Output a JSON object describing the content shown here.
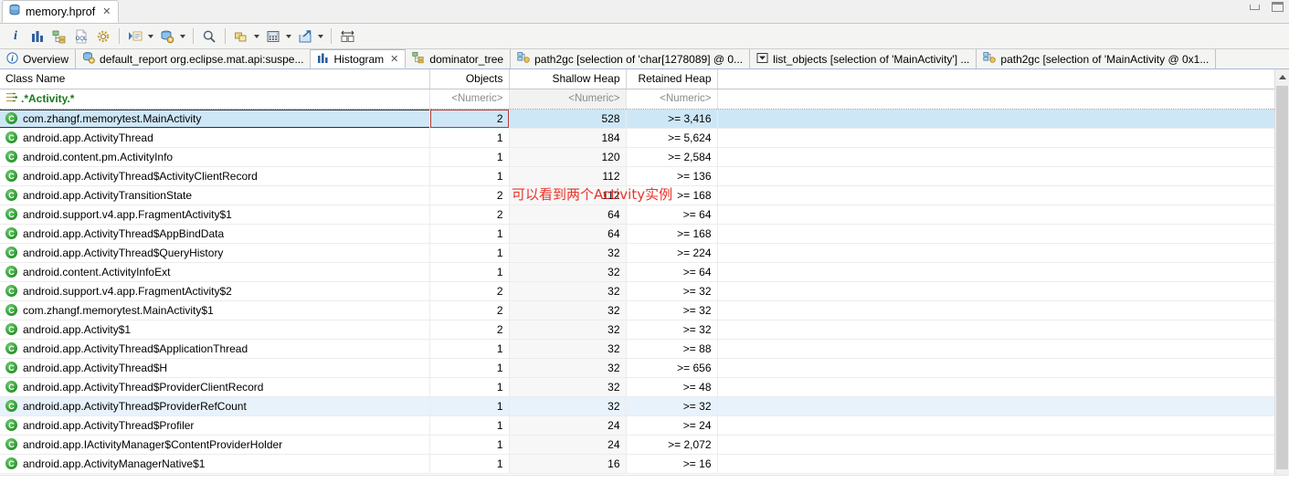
{
  "window": {
    "file_tab": {
      "title": "memory.hprof",
      "icon": "heap-dump-icon",
      "close": "✕"
    },
    "controls": {
      "minimize": "minimize-icon",
      "maximize": "maximize-icon"
    }
  },
  "toolbar": {
    "items": [
      {
        "name": "heap-dump-overview-icon",
        "glyph": "i",
        "arrow": false
      },
      {
        "name": "histogram-icon",
        "glyph": "bars",
        "arrow": false
      },
      {
        "name": "dominator-tree-icon",
        "glyph": "tree",
        "arrow": false
      },
      {
        "name": "oql-icon",
        "glyph": "oql",
        "arrow": false
      },
      {
        "name": "settings-icon",
        "glyph": "gear",
        "arrow": false
      },
      {
        "name": "sep-1",
        "glyph": "sep",
        "arrow": false
      },
      {
        "name": "run-expert-system-test-icon",
        "glyph": "runlist",
        "arrow": true
      },
      {
        "name": "query-browser-icon",
        "glyph": "queryball",
        "arrow": true
      },
      {
        "name": "sep-2",
        "glyph": "sep",
        "arrow": false
      },
      {
        "name": "find-icon",
        "glyph": "magnifier",
        "arrow": false
      },
      {
        "name": "sep-3",
        "glyph": "sep",
        "arrow": false
      },
      {
        "name": "group-by-icon",
        "glyph": "stack",
        "arrow": true
      },
      {
        "name": "calculator-icon",
        "glyph": "calc",
        "arrow": true
      },
      {
        "name": "export-icon",
        "glyph": "export",
        "arrow": true
      },
      {
        "name": "sep-4",
        "glyph": "sep",
        "arrow": false
      },
      {
        "name": "compare-icon",
        "glyph": "compare",
        "arrow": false
      }
    ]
  },
  "view_tabs": [
    {
      "label": "Overview",
      "icon": "info-icon",
      "active": false,
      "closable": false
    },
    {
      "label": "default_report  org.eclipse.mat.api:suspe...",
      "icon": "report-icon",
      "active": false,
      "closable": false
    },
    {
      "label": "Histogram",
      "icon": "histogram-icon",
      "active": true,
      "closable": true,
      "close": "✕"
    },
    {
      "label": "dominator_tree",
      "icon": "tree-icon",
      "active": false,
      "closable": false
    },
    {
      "label": "path2gc [selection of 'char[1278089] @ 0...",
      "icon": "path2gc-icon",
      "active": false,
      "closable": false
    },
    {
      "label": "list_objects [selection of 'MainActivity'] ...",
      "icon": "list-objects-icon",
      "active": false,
      "closable": false
    },
    {
      "label": "path2gc [selection of 'MainActivity @ 0x1...",
      "icon": "path2gc-icon",
      "active": false,
      "closable": false
    }
  ],
  "table": {
    "columns": [
      "Class Name",
      "Objects",
      "Shallow Heap",
      "Retained Heap"
    ],
    "filter_row": {
      "class_filter": ".*Activity.*",
      "objects_filter": "<Numeric>",
      "shallow_filter": "<Numeric>",
      "retained_filter": "<Numeric>",
      "filter_icon": "regex-filter-icon"
    },
    "rows": [
      {
        "class": "com.zhangf.memorytest.MainActivity",
        "objects": "2",
        "shallow": "528",
        "retained": ">= 3,416",
        "selected": true,
        "hover": false
      },
      {
        "class": "android.app.ActivityThread",
        "objects": "1",
        "shallow": "184",
        "retained": ">= 5,624",
        "selected": false,
        "hover": false
      },
      {
        "class": "android.content.pm.ActivityInfo",
        "objects": "1",
        "shallow": "120",
        "retained": ">= 2,584",
        "selected": false,
        "hover": false
      },
      {
        "class": "android.app.ActivityThread$ActivityClientRecord",
        "objects": "1",
        "shallow": "112",
        "retained": ">= 136",
        "selected": false,
        "hover": false
      },
      {
        "class": "android.app.ActivityTransitionState",
        "objects": "2",
        "shallow": "112",
        "retained": ">= 168",
        "selected": false,
        "hover": false
      },
      {
        "class": "android.support.v4.app.FragmentActivity$1",
        "objects": "2",
        "shallow": "64",
        "retained": ">= 64",
        "selected": false,
        "hover": false
      },
      {
        "class": "android.app.ActivityThread$AppBindData",
        "objects": "1",
        "shallow": "64",
        "retained": ">= 168",
        "selected": false,
        "hover": false
      },
      {
        "class": "android.app.ActivityThread$QueryHistory",
        "objects": "1",
        "shallow": "32",
        "retained": ">= 224",
        "selected": false,
        "hover": false
      },
      {
        "class": "android.content.ActivityInfoExt",
        "objects": "1",
        "shallow": "32",
        "retained": ">= 64",
        "selected": false,
        "hover": false
      },
      {
        "class": "android.support.v4.app.FragmentActivity$2",
        "objects": "2",
        "shallow": "32",
        "retained": ">= 32",
        "selected": false,
        "hover": false
      },
      {
        "class": "com.zhangf.memorytest.MainActivity$1",
        "objects": "2",
        "shallow": "32",
        "retained": ">= 32",
        "selected": false,
        "hover": false
      },
      {
        "class": "android.app.Activity$1",
        "objects": "2",
        "shallow": "32",
        "retained": ">= 32",
        "selected": false,
        "hover": false
      },
      {
        "class": "android.app.ActivityThread$ApplicationThread",
        "objects": "1",
        "shallow": "32",
        "retained": ">= 88",
        "selected": false,
        "hover": false
      },
      {
        "class": "android.app.ActivityThread$H",
        "objects": "1",
        "shallow": "32",
        "retained": ">= 656",
        "selected": false,
        "hover": false
      },
      {
        "class": "android.app.ActivityThread$ProviderClientRecord",
        "objects": "1",
        "shallow": "32",
        "retained": ">= 48",
        "selected": false,
        "hover": false
      },
      {
        "class": "android.app.ActivityThread$ProviderRefCount",
        "objects": "1",
        "shallow": "32",
        "retained": ">= 32",
        "selected": false,
        "hover": true
      },
      {
        "class": "android.app.ActivityThread$Profiler",
        "objects": "1",
        "shallow": "24",
        "retained": ">= 24",
        "selected": false,
        "hover": false
      },
      {
        "class": "android.app.IActivityManager$ContentProviderHolder",
        "objects": "1",
        "shallow": "24",
        "retained": ">= 2,072",
        "selected": false,
        "hover": false
      },
      {
        "class": "android.app.ActivityManagerNative$1",
        "objects": "1",
        "shallow": "16",
        "retained": ">= 16",
        "selected": false,
        "hover": false
      }
    ]
  },
  "annotation": {
    "text": "可以看到两个Activity实例",
    "color": "#e8342a"
  },
  "scrollbar": {
    "up_arrow": "scroll-up-icon"
  },
  "colors": {
    "selection": "#cee7f7",
    "hover": "#e8f2fb",
    "filter_text": "#1a7a1a",
    "focus_border": "#b33a3a"
  }
}
